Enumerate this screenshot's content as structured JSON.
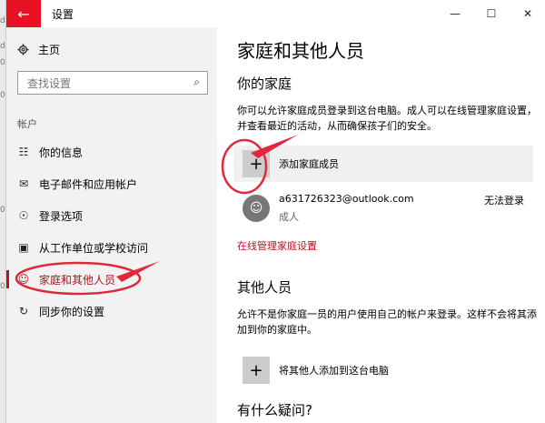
{
  "window": {
    "title": "设置",
    "back_glyph": "←",
    "minimize_glyph": "—",
    "maximize_glyph": "☐",
    "close_glyph": "✕"
  },
  "sidebar": {
    "home_label": "主页",
    "search_placeholder": "查找设置",
    "section_title": "帐户",
    "items": [
      {
        "label": "你的信息",
        "icon": "person-card-icon"
      },
      {
        "label": "电子邮件和应用帐户",
        "icon": "mail-icon"
      },
      {
        "label": "登录选项",
        "icon": "key-icon"
      },
      {
        "label": "从工作单位或学校访问",
        "icon": "briefcase-icon"
      },
      {
        "label": "家庭和其他人员",
        "icon": "people-icon",
        "active": true
      },
      {
        "label": "同步你的设置",
        "icon": "sync-icon"
      }
    ]
  },
  "main": {
    "page_title": "家庭和其他人员",
    "family": {
      "heading": "你的家庭",
      "description": "你可以允许家庭成员登录到这台电脑。成人可以在线管理家庭设置，并查看最近的活动，从而确保孩子们的安全。",
      "add_label": "添加家庭成员",
      "member": {
        "email": "a631726323@outlook.com",
        "role": "成人",
        "status": "无法登录"
      },
      "manage_link": "在线管理家庭设置"
    },
    "others": {
      "heading": "其他人员",
      "description": "允许不是你家庭一员的用户使用自己的帐户来登录。这样不会将其添加到你的家庭中。",
      "add_label": "将其他人添加到这台电脑"
    },
    "faq_heading": "有什么疑问?"
  },
  "colors": {
    "accent": "#b4131f",
    "back_button": "#e81123",
    "sidebar_bg": "#f2f2f2",
    "annotation": "#e0283a"
  },
  "edge_fragments": [
    "d",
    "d",
    "0",
    "0",
    "0",
    "0"
  ]
}
